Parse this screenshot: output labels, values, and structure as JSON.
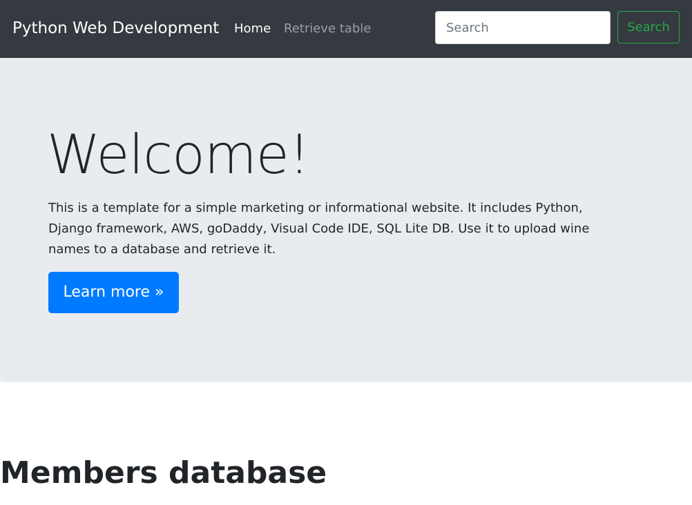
{
  "navbar": {
    "brand": "Python Web Development",
    "links": [
      {
        "label": "Home"
      },
      {
        "label": "Retrieve table"
      }
    ],
    "search": {
      "placeholder": "Search",
      "value": "",
      "button_label": "Search"
    }
  },
  "hero": {
    "title": "Welcome!",
    "description": "This is a template for a simple marketing or informational website. It includes Python, Django framework, AWS, goDaddy, Visual Code IDE, SQL Lite DB. Use it to upload wine names to a database and retrieve it.",
    "button_label": "Learn more »"
  },
  "section": {
    "title": "Members database"
  },
  "colors": {
    "navbar_bg": "#343a40",
    "hero_bg": "#e9ecef",
    "primary": "#007bff",
    "success": "#28a745"
  }
}
